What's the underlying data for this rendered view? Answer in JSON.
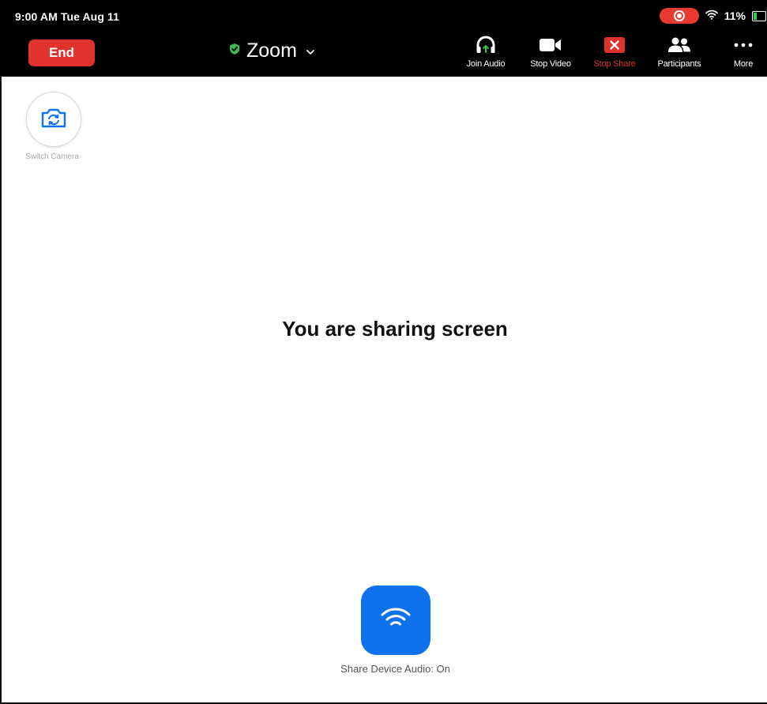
{
  "status_bar": {
    "time": "9:00 AM  Tue Aug 11",
    "battery_percent": "11%",
    "battery_level": 0.11,
    "wifi_icon": "wifi-icon",
    "recording_icon": "screen-recording-icon"
  },
  "header": {
    "end_label": "End",
    "meeting_name": "Zoom",
    "security_icon": "shield-check-icon",
    "title_dropdown_icon": "chevron-down-icon"
  },
  "toolbar": {
    "items": [
      {
        "label": "Join Audio",
        "icon": "headphones-icon"
      },
      {
        "label": "Stop Video",
        "icon": "video-camera-icon"
      },
      {
        "label": "Stop Share",
        "icon": "stop-share-icon"
      },
      {
        "label": "Participants",
        "icon": "participants-icon"
      },
      {
        "label": "More",
        "icon": "more-dots-icon"
      }
    ]
  },
  "main": {
    "switch_camera_label": "Switch Camera",
    "sharing_message": "You are sharing screen",
    "share_audio_label": "Share Device Audio: On"
  },
  "colors": {
    "toolbar_bg": "#000000",
    "end_red": "#e0332d",
    "shield_green": "#3dbb4f",
    "accent_blue": "#0e72ed"
  }
}
